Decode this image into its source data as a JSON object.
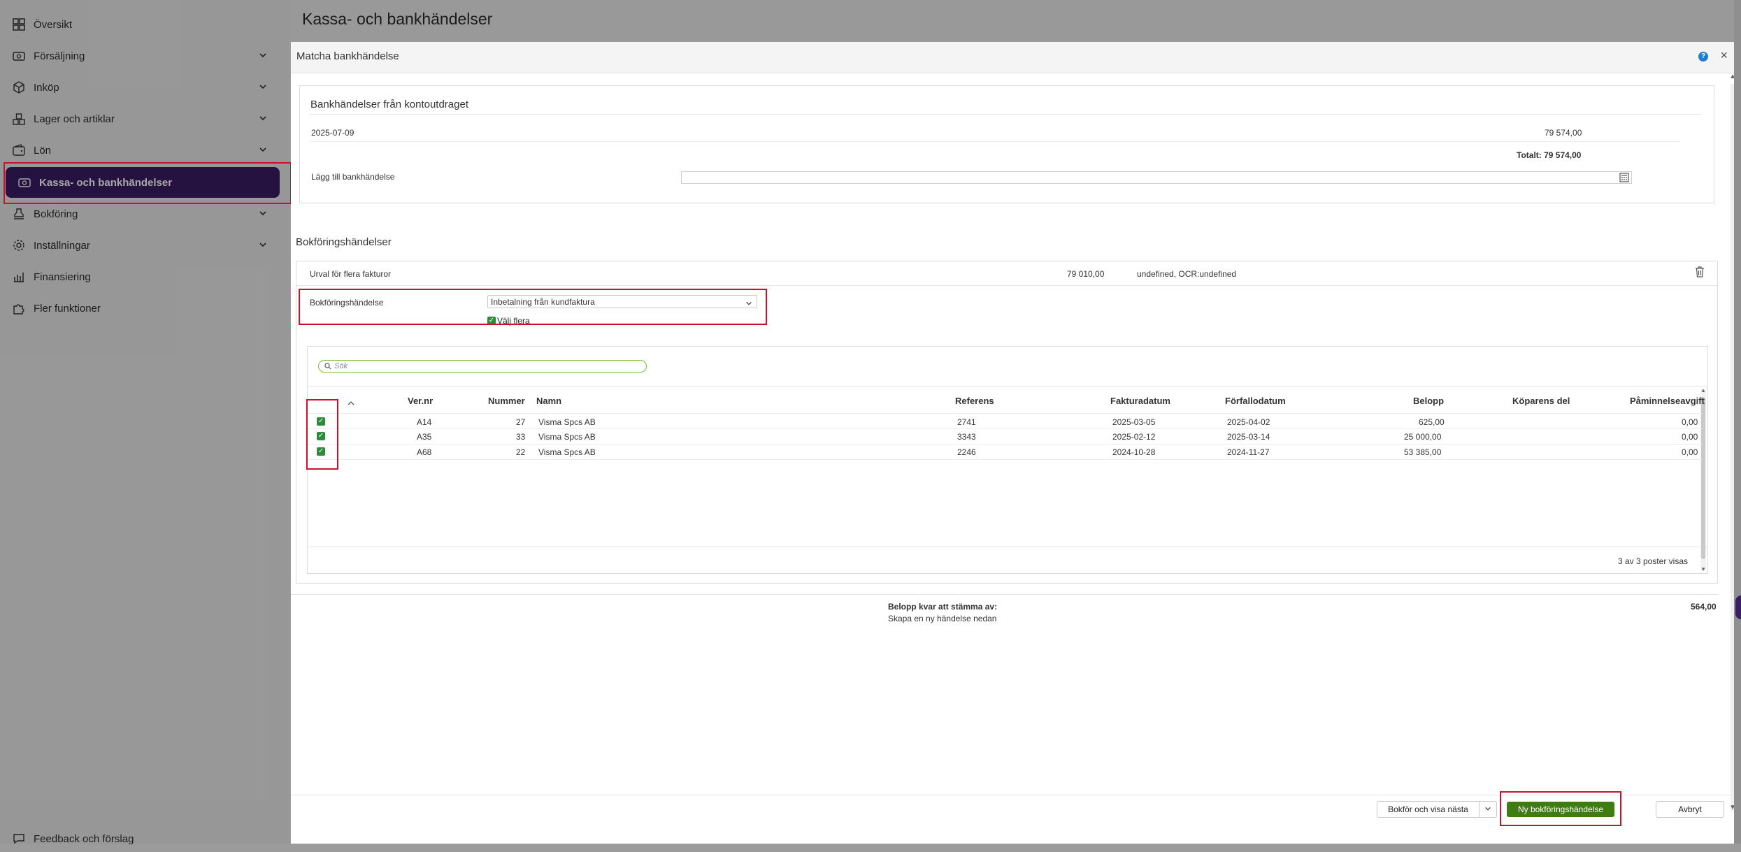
{
  "sidebar": {
    "items": [
      {
        "label": "Översikt",
        "icon": "grid-icon",
        "has_chevron": false
      },
      {
        "label": "Försäljning",
        "icon": "sales-icon",
        "has_chevron": true
      },
      {
        "label": "Inköp",
        "icon": "box-icon",
        "has_chevron": true
      },
      {
        "label": "Lager och artiklar",
        "icon": "stock-icon",
        "has_chevron": true
      },
      {
        "label": "Lön",
        "icon": "wallet-icon",
        "has_chevron": true
      },
      {
        "label": "Kassa- och bankhändelser",
        "icon": "bank-icon",
        "active": true
      },
      {
        "label": "Bokföring",
        "icon": "stamp-icon",
        "has_chevron": true
      },
      {
        "label": "Inställningar",
        "icon": "gear-icon",
        "has_chevron": true
      },
      {
        "label": "Finansiering",
        "icon": "finance-icon",
        "has_chevron": false
      },
      {
        "label": "Fler funktioner",
        "icon": "puzzle-icon",
        "has_chevron": false
      }
    ],
    "feedback": "Feedback och förslag"
  },
  "header": {
    "title": "Kassa- och bankhändelser"
  },
  "modal": {
    "title": "Matcha bankhändelse",
    "bank_section": {
      "title": "Bankhändelser från kontoutdraget",
      "date": "2025-07-09",
      "amount": "79 574,00",
      "total": "Totalt: 79 574,00",
      "add_label": "Lägg till bankhändelse",
      "add_value": ""
    },
    "booking_section": {
      "title": "Bokföringshändelser",
      "selection_label": "Urval för flera fakturor",
      "selection_amount": "79 010,00",
      "selection_ref": "undefined, OCR:undefined",
      "event_label": "Bokföringshändelse",
      "event_value": "Inbetalning från kundfaktura",
      "choose_multiple": "Välj flera",
      "search_placeholder": "Sök"
    },
    "table": {
      "columns": [
        "Ver.nr",
        "Nummer",
        "Namn",
        "Referens",
        "Fakturadatum",
        "Förfallodatum",
        "Belopp",
        "Köparens del",
        "Påminnelseavgift"
      ],
      "rows": [
        {
          "ver": "A14",
          "num": "27",
          "name": "Visma Spcs AB",
          "ref": "2741",
          "inv_date": "2025-03-05",
          "due_date": "2025-04-02",
          "amount": "625,00",
          "buyer": "",
          "fee": "0,00"
        },
        {
          "ver": "A35",
          "num": "33",
          "name": "Visma Spcs AB",
          "ref": "3343",
          "inv_date": "2025-02-12",
          "due_date": "2025-03-14",
          "amount": "25 000,00",
          "buyer": "",
          "fee": "0,00"
        },
        {
          "ver": "A68",
          "num": "22",
          "name": "Visma Spcs AB",
          "ref": "2246",
          "inv_date": "2024-10-28",
          "due_date": "2024-11-27",
          "amount": "53 385,00",
          "buyer": "",
          "fee": "0,00"
        }
      ],
      "footer": "3 av 3 poster visas"
    },
    "remaining": {
      "label": "Belopp kvar att stämma av:",
      "sub": "Skapa en ny händelse nedan",
      "value": "564,00"
    },
    "buttons": {
      "book_next": "Bokför och visa nästa",
      "new_event": "Ny bokföringshändelse",
      "cancel": "Avbryt"
    }
  },
  "colors": {
    "accent": "#3a1d64",
    "primary_button": "#3f7d12",
    "highlight": "#d0102b",
    "check": "#2e8b3a"
  }
}
